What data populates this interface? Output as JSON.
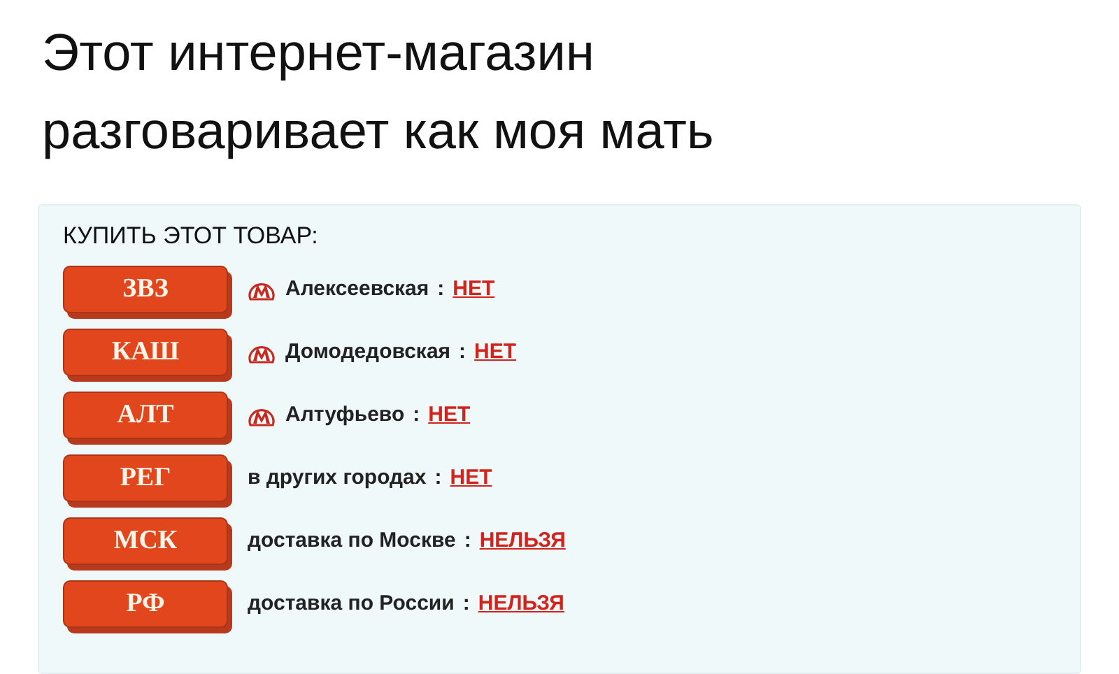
{
  "caption": "Этот интернет-магазин разговаривает как моя мать",
  "panel": {
    "heading": "КУПИТЬ ЭТОТ ТОВАР:",
    "rows": [
      {
        "code": "ЗВЗ",
        "kind": "metro",
        "place": "Алексеевская",
        "separator": ":",
        "answer": "НЕТ"
      },
      {
        "code": "КАШ",
        "kind": "metro",
        "place": "Домодедовская",
        "separator": ":",
        "answer": "НЕТ"
      },
      {
        "code": "АЛТ",
        "kind": "metro",
        "place": "Алтуфьево",
        "separator": ":",
        "answer": "НЕТ"
      },
      {
        "code": "РЕГ",
        "kind": "plain",
        "place": "в других городах",
        "separator": ":",
        "answer": "НЕТ"
      },
      {
        "code": "МСК",
        "kind": "plain",
        "place": "доставка по Москве",
        "separator": ":",
        "answer": "НЕЛЬЗЯ"
      },
      {
        "code": "РФ",
        "kind": "plain",
        "place": "доставка по России",
        "separator": ":",
        "answer": "НЕЛЬЗЯ"
      }
    ]
  }
}
